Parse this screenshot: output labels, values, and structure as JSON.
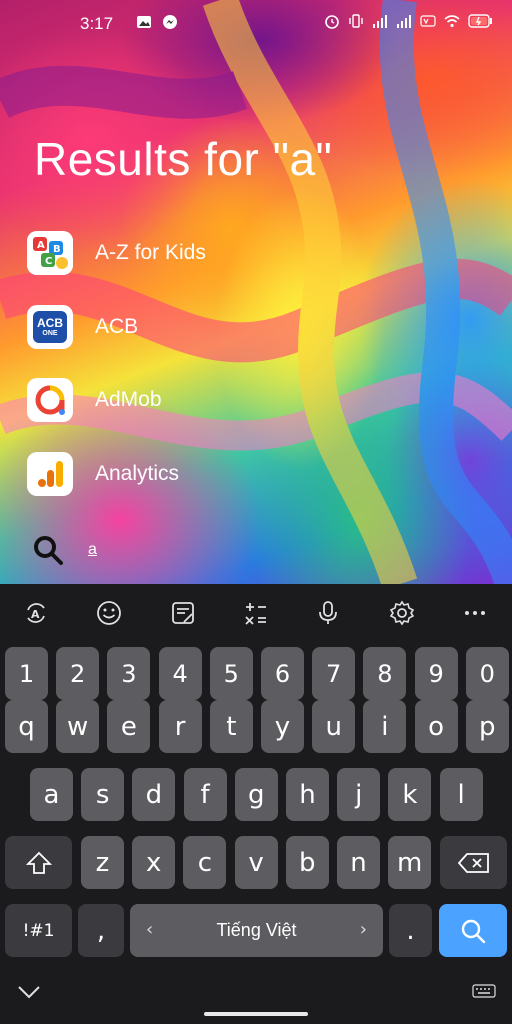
{
  "status_bar": {
    "time": "3:17"
  },
  "search": {
    "title": "Results for \"a\"",
    "query": "a"
  },
  "results": [
    {
      "label": "A-Z for Kids",
      "icon": "az-kids-icon"
    },
    {
      "label": "ACB",
      "icon": "acb-icon",
      "icon_text_top": "ACB",
      "icon_text_bottom": "ONE"
    },
    {
      "label": "AdMob",
      "icon": "admob-icon"
    },
    {
      "label": "Analytics",
      "icon": "analytics-icon"
    }
  ],
  "keyboard": {
    "number_row": [
      "1",
      "2",
      "3",
      "4",
      "5",
      "6",
      "7",
      "8",
      "9",
      "0"
    ],
    "row1": [
      "q",
      "w",
      "e",
      "r",
      "t",
      "y",
      "u",
      "i",
      "o",
      "p"
    ],
    "row2": [
      "a",
      "s",
      "d",
      "f",
      "g",
      "h",
      "j",
      "k",
      "l"
    ],
    "row3": [
      "z",
      "x",
      "c",
      "v",
      "b",
      "n",
      "m"
    ],
    "symbols_label": "!#1",
    "comma_label": ",",
    "space_label": "Tiếng Việt",
    "period_label": ".",
    "space_left_arrow": "‹",
    "space_right_arrow": "›"
  },
  "colors": {
    "key_bg": "#5d5d61",
    "key_dark_bg": "#3b3b3f",
    "keyboard_bg": "#1b1b1d",
    "search_key": "#4ba3ff"
  }
}
